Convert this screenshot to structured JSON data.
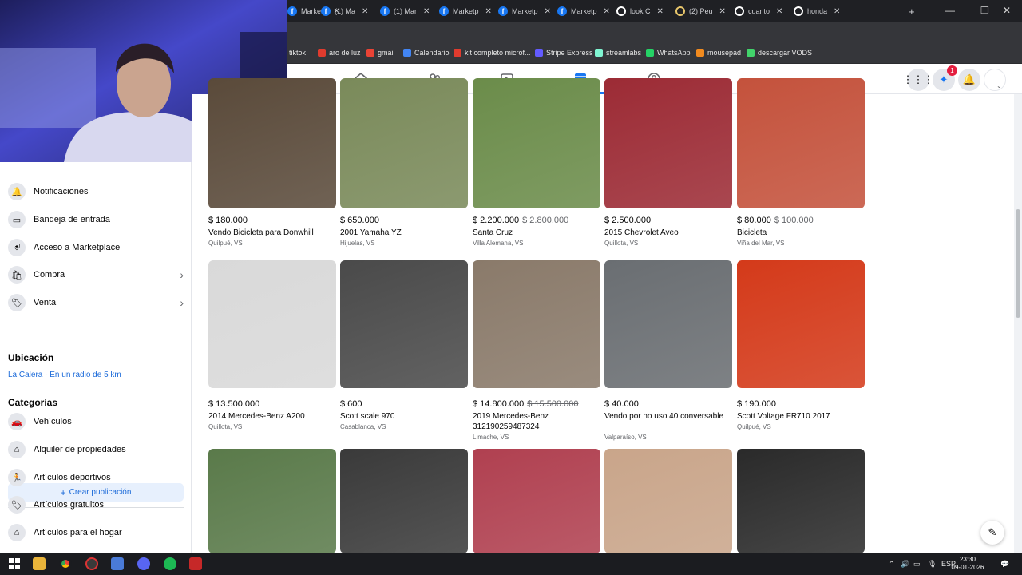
{
  "browser": {
    "tabs": [
      {
        "label": "Marketp",
        "type": "fb"
      },
      {
        "label": "(1) Ma",
        "type": "fb"
      },
      {
        "label": "(1) Mar",
        "type": "fb"
      },
      {
        "label": "Marketp",
        "type": "fb"
      },
      {
        "label": "Marketp",
        "type": "fb"
      },
      {
        "label": "Marketp",
        "type": "fb"
      },
      {
        "label": "look C",
        "type": "google"
      },
      {
        "label": "(2) Peu",
        "type": "other"
      },
      {
        "label": "cuanto",
        "type": "google"
      },
      {
        "label": "honda",
        "type": "google"
      }
    ],
    "new_tab": "+",
    "bookmarks": [
      {
        "label": "tiktok",
        "color": "#111111"
      },
      {
        "label": "aro de luz",
        "color": "#e03b2e"
      },
      {
        "label": "gmail",
        "color": "#ea4335"
      },
      {
        "label": "Calendario",
        "color": "#4285f4"
      },
      {
        "label": "kit completo microf...",
        "color": "#e03b2e"
      },
      {
        "label": "Stripe Express",
        "color": "#635bff"
      },
      {
        "label": "streamlabs",
        "color": "#80f5d2"
      },
      {
        "label": "WhatsApp",
        "color": "#25d366"
      },
      {
        "label": "mousepad",
        "color": "#f28b1f"
      },
      {
        "label": "descargar VODS",
        "color": "#42d36b"
      }
    ]
  },
  "fbnav": {
    "notification_count": "1"
  },
  "sidebar": {
    "items": [
      {
        "label": "Notificaciones",
        "icon": "bell-icon",
        "glyph": "🔔"
      },
      {
        "label": "Bandeja de entrada",
        "icon": "inbox-icon",
        "glyph": "▭"
      },
      {
        "label": "Acceso a Marketplace",
        "icon": "shield-icon",
        "glyph": "⛨"
      },
      {
        "label": "Compra",
        "icon": "bag-icon",
        "glyph": "🛍"
      },
      {
        "label": "Venta",
        "icon": "tag-icon",
        "glyph": "🏷"
      }
    ],
    "create_label": "Crear publicación",
    "location_heading": "Ubicación",
    "location_value": "La Calera · En un radio de 5 km",
    "categories_heading": "Categorías",
    "categories": [
      {
        "label": "Vehículos",
        "icon": "car-icon",
        "glyph": "🚗"
      },
      {
        "label": "Alquiler de propiedades",
        "icon": "house-icon",
        "glyph": "⌂"
      },
      {
        "label": "Artículos deportivos",
        "icon": "runner-icon",
        "glyph": "🏃"
      },
      {
        "label": "Artículos gratuitos",
        "icon": "gift-tag-icon",
        "glyph": "🏷"
      },
      {
        "label": "Artículos para el hogar",
        "icon": "home-goods-icon",
        "glyph": "⌂"
      }
    ]
  },
  "listings": [
    {
      "price": "$ 180.000",
      "old_price": "",
      "title": "Vendo Bicicleta para Donwhill",
      "location": "Quilpué, VS",
      "color": "#5a4a3a"
    },
    {
      "price": "$ 650.000",
      "old_price": "",
      "title": "2001 Yamaha YZ",
      "location": "Hijuelas, VS",
      "color": "#7a8a5a"
    },
    {
      "price": "$ 2.200.000",
      "old_price": "$ 2.800.000",
      "title": "Santa Cruz",
      "location": "Villa Alemana, VS",
      "color": "#6b8c4a"
    },
    {
      "price": "$ 2.500.000",
      "old_price": "",
      "title": "2015 Chevrolet Aveo",
      "location": "Quillota, VS",
      "color": "#9c2b35"
    },
    {
      "price": "$ 80.000",
      "old_price": "$ 100.000",
      "title": "Bicicleta",
      "location": "Viña del Mar, VS",
      "color": "#c4523c"
    },
    {
      "price": "$ 13.500.000",
      "old_price": "",
      "title": "2014 Mercedes-Benz A200",
      "location": "Quillota, VS",
      "color": "#d9d9d9"
    },
    {
      "price": "$ 600",
      "old_price": "",
      "title": "Scott scale 970",
      "location": "Casablanca, VS",
      "color": "#4a4a4a"
    },
    {
      "price": "$ 14.800.000",
      "old_price": "$ 15.500.000",
      "title": "2019 Mercedes-Benz 312190259487324",
      "location": "Limache, VS",
      "color": "#8a7a6a"
    },
    {
      "price": "$ 40.000",
      "old_price": "",
      "title": "Vendo por no uso 40 conversable",
      "location": "Valparaíso, VS",
      "color": "#6a6e72"
    },
    {
      "price": "$ 190.000",
      "old_price": "",
      "title": "Scott Voltage FR710 2017",
      "location": "Quilpué, VS",
      "color": "#d43a1a"
    },
    {
      "price": "",
      "old_price": "",
      "title": "",
      "location": "",
      "color": "#5a7a4a"
    },
    {
      "price": "",
      "old_price": "",
      "title": "",
      "location": "",
      "color": "#3a3a3a"
    },
    {
      "price": "",
      "old_price": "",
      "title": "",
      "location": "",
      "color": "#b04050"
    },
    {
      "price": "",
      "old_price": "",
      "title": "",
      "location": "",
      "color": "#c9a58a"
    },
    {
      "price": "",
      "old_price": "",
      "title": "",
      "location": "",
      "color": "#2a2a2a"
    }
  ],
  "taskbar": {
    "language": "ESP",
    "time": "23:30",
    "date": "09-01-2026"
  }
}
